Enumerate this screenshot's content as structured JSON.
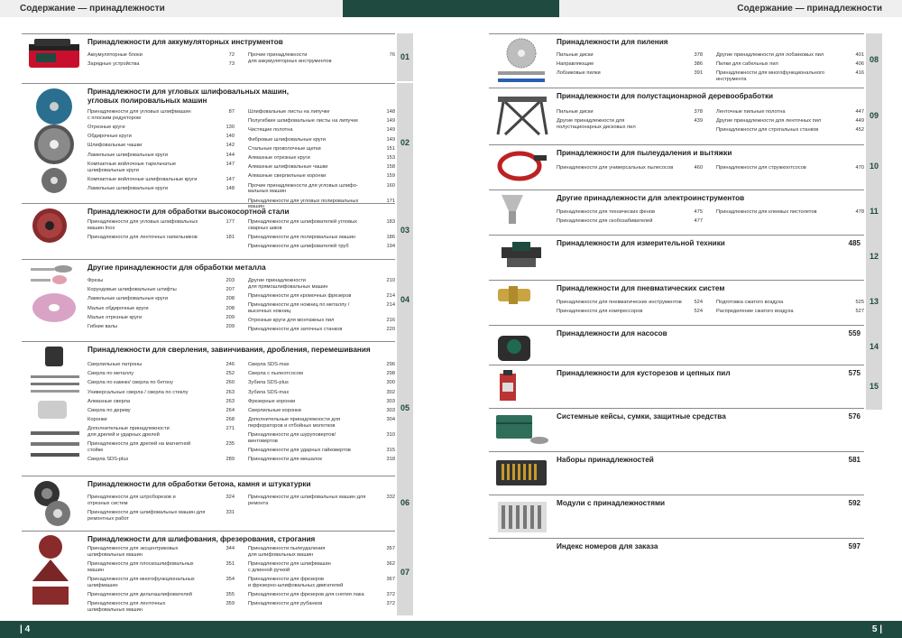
{
  "header": {
    "left_title": "Содержание — принадлежности",
    "right_title": "Содержание — принадлежности"
  },
  "footer": {
    "left_page": "| 4",
    "right_page": "5 |"
  },
  "left_sections": [
    {
      "tab": "01",
      "title": "Принадлежности для аккумуляторных инструментов",
      "items_left": [
        [
          "Аккумуляторные блоки",
          "72"
        ],
        [
          "Зарядные устройства",
          "73"
        ]
      ],
      "items_right": [
        [
          "Прочие принадлежности\nдля аккумуляторных инструментов",
          "76"
        ]
      ]
    },
    {
      "tab": "02",
      "title": "Принадлежности для угловых шлифовальных машин,\nугловых полировальных машин",
      "items_left": [
        [
          "Принадлежности для угловых шлифмашин\nс плоским редуктором",
          "87"
        ],
        [
          "Отрезные круги",
          "130"
        ],
        [
          "Обдирочные круги",
          "140"
        ],
        [
          "Шлифовальные чашки",
          "142"
        ],
        [
          "Ламельные шлифовальные круги",
          "144"
        ],
        [
          "Компактные войлочные тарельчатые\nшлифовальные круги",
          "147"
        ],
        [
          "Компактные войлочные шлифовальные круги",
          "147"
        ],
        [
          "Ламельные шлифовальные круги",
          "148"
        ]
      ],
      "items_right": [
        [
          "Шлифовальные листы на липучке",
          "148"
        ],
        [
          "Полугибкие шлифовальные листы на липучке",
          "149"
        ],
        [
          "Чистящие полотна",
          "149"
        ],
        [
          "Фибровые шлифовальные круги",
          "149"
        ],
        [
          "Стальные проволочные щетки",
          "151"
        ],
        [
          "Алмазные отрезные круги",
          "153"
        ],
        [
          "Алмазные шлифовальные чашки",
          "158"
        ],
        [
          "Алмазные сверлильные коронки",
          "159"
        ],
        [
          "Прочие принадлежности для угловых шлифо-\nвальных машин",
          "160"
        ],
        [
          "Принадлежности для угловых полировальных\nмашин",
          "171"
        ]
      ]
    },
    {
      "tab": "03",
      "title": "Принадлежности для обработки высокосортной стали",
      "items_left": [
        [
          "Принадлежности для угловых шлифовальных\nмашин Inox",
          "177"
        ],
        [
          "Принадлежности для ленточных напильников",
          "181"
        ]
      ],
      "items_right": [
        [
          "Принадлежности для шлифователей угловых\nсварных швов",
          "183"
        ],
        [
          "Принадлежности для полировальных машин",
          "186"
        ],
        [
          "Принадлежности для шлифователей труб",
          "194"
        ]
      ]
    },
    {
      "tab": "04",
      "title": "Другие принадлежности для обработки металла",
      "items_left": [
        [
          "Фрезы",
          "203"
        ],
        [
          "Корундовые шлифовальные штифты",
          "207"
        ],
        [
          "Ламельные шлифовальные круги",
          "208"
        ],
        [
          "Малые обдирочные круги",
          "208"
        ],
        [
          "Малые отрезные круги",
          "209"
        ],
        [
          "Гибкие валы",
          "209"
        ]
      ],
      "items_right": [
        [
          "Другие принадлежности\nдля прямошлифовальных машин",
          "210"
        ],
        [
          "Принадлежности для кромочных фрезеров",
          "214"
        ],
        [
          "Принадлежности для ножниц по металлу /\nвысечных ножниц",
          "214"
        ],
        [
          "Отрезные круги для монтажных пил",
          "216"
        ],
        [
          "Принадлежности для заточных станков",
          "220"
        ]
      ]
    },
    {
      "tab": "05",
      "title": "Принадлежности для сверления, завинчивания, дробления, перемешивания",
      "items_left": [
        [
          "Сверлильные патроны",
          "246"
        ],
        [
          "Сверла по металлу",
          "252"
        ],
        [
          "Сверла по камню/ сверла по бетону",
          "260"
        ],
        [
          "Универсальные сверла / сверла по стеклу",
          "263"
        ],
        [
          "Алмазные сверла",
          "263"
        ],
        [
          "Сверла по дереву",
          "264"
        ],
        [
          "Коронки",
          "268"
        ],
        [
          "Дополнительные принадлежности\nдля дрелей и ударных дрелей",
          "271"
        ],
        [
          "Принадлежности для дрелей на магнитной\nстойке",
          "235"
        ],
        [
          "Сверла SDS-plus",
          "289"
        ]
      ],
      "items_right": [
        [
          "Сверла SDS-max",
          "296"
        ],
        [
          "Сверла с пылеотсосом",
          "298"
        ],
        [
          "Зубила SDS-plus",
          "300"
        ],
        [
          "Зубила SDS-max",
          "302"
        ],
        [
          "Фрезерные коронки",
          "303"
        ],
        [
          "Сверлильные коронки",
          "303"
        ],
        [
          "Дополнительные принадлежности для\nперфораторов и отбойных молотков",
          "304"
        ],
        [
          "Принадлежности для шуруповертов/\nвинтовертов",
          "310"
        ],
        [
          "Принадлежности для ударных гайковертов",
          "315"
        ],
        [
          "Принадлежности для мешалок",
          "318"
        ]
      ]
    },
    {
      "tab": "06",
      "title": "Принадлежности для обработки бетона, камня и штукатурки",
      "items_left": [
        [
          "Принадлежности для штроборезов и\nотрезных систем",
          "324"
        ],
        [
          "Принадлежности для шлифовальных машин для\nремонтных работ",
          "331"
        ]
      ],
      "items_right": [
        [
          "Принадлежности для шлифовальных машин для\nремонта",
          "332"
        ]
      ]
    },
    {
      "tab": "07",
      "title": "Принадлежности для шлифования, фрезерования, строгания",
      "items_left": [
        [
          "Принадлежности для эксцентриковых\nшлифовальных машин",
          "344"
        ],
        [
          "Принадлежности для плоскошлифовальных\nмашин",
          "351"
        ],
        [
          "Принадлежности для многофункциональных\nшлифмашин",
          "354"
        ],
        [
          "Принадлежности для дельташлифователей",
          "355"
        ],
        [
          "Принадлежности для ленточных\nшлифовальных машин",
          "359"
        ]
      ],
      "items_right": [
        [
          "Принадлежности пылеудаления\nдля шлифовальных машин",
          "357"
        ],
        [
          "Принадлежности для шлифмашин\nс длинной ручкой",
          "362"
        ],
        [
          "Принадлежности для фрезеров\nи фрезерно-шлифовальных двигателей",
          "367"
        ],
        [
          "Принадлежности для фрезеров для снятия лака",
          "372"
        ],
        [
          "Принадлежности для рубанков",
          "372"
        ]
      ]
    }
  ],
  "right_sections": [
    {
      "tab": "08",
      "title": "Принадлежности для пиления",
      "items_left": [
        [
          "Пильные диски",
          "378"
        ],
        [
          "Направляющие",
          "386"
        ],
        [
          "Лобзиковые пилки",
          "391"
        ]
      ],
      "items_right": [
        [
          "Другие принадлежности для лобзиковых пил",
          "401"
        ],
        [
          "Пилки для сабельных пил",
          "406"
        ],
        [
          "Принадлежности для многофункционального\nинструмента",
          "416"
        ]
      ]
    },
    {
      "tab": "09",
      "title": "Принадлежности для полустационарной деревообработки",
      "items_left": [
        [
          "Пильные диски",
          "378"
        ],
        [
          "Другие принадлежности для\nполустационарных дисковых пил",
          "439"
        ]
      ],
      "items_right": [
        [
          "Ленточные пильные полотна",
          "447"
        ],
        [
          "Другие принадлежности для ленточных пил",
          "449"
        ],
        [
          "Принадлежности для строгальных станков",
          "452"
        ]
      ]
    },
    {
      "tab": "10",
      "title": "Принадлежности для пылеудаления и вытяжки",
      "items_left": [
        [
          "Принадлежности для универсальных пылесосов",
          "460"
        ]
      ],
      "items_right": [
        [
          "Принадлежности для стружкоотсосов",
          "470"
        ]
      ]
    },
    {
      "tab": "11",
      "title": "Другие принадлежности для электроинструментов",
      "items_left": [
        [
          "Принадлежности для технических фенов",
          "475"
        ],
        [
          "Принадлежности для скобозабивателей",
          "477"
        ]
      ],
      "items_right": [
        [
          "Принадлежности для клеевых пистолетов",
          "478"
        ]
      ]
    },
    {
      "tab": "12",
      "title": "Принадлежности для измерительной техники",
      "page": "485"
    },
    {
      "tab": "13",
      "title": "Принадлежности для пневматических систем",
      "items_left": [
        [
          "Принадлежности для пневматических инструментов",
          "524"
        ],
        [
          "Принадлежности для компрессоров",
          "524"
        ]
      ],
      "items_right": [
        [
          "Подготовка сжатого воздуха",
          "525"
        ],
        [
          "Распределение сжатого воздуха",
          "527"
        ]
      ]
    },
    {
      "tab": "14",
      "title": "Принадлежности для насосов",
      "page": "559"
    },
    {
      "tab": "15",
      "title": "Принадлежности для кусторезов и цепных пил",
      "page": "575"
    },
    {
      "tab": "",
      "title": "Системные кейсы, сумки, защитные средства",
      "page": "576"
    },
    {
      "tab": "",
      "title": "Наборы принадлежностей",
      "page": "581"
    },
    {
      "tab": "",
      "title": "Модули с принадлежностями",
      "page": "592"
    },
    {
      "tab": "",
      "title": "Индекс номеров для заказа",
      "page": "597"
    }
  ],
  "colors": {
    "brand": "#1e4a40",
    "tab": "#d8d8d8"
  },
  "icons": [
    "battery-pack-image",
    "grinding-disc-image",
    "flap-disc-image",
    "mounted-points-image",
    "drill-bits-image",
    "concrete-grinder-image",
    "sanding-sheets-image",
    "saw-blade-image",
    "workbench-stand-image",
    "vacuum-hose-image",
    "heat-gun-nozzle-image",
    "measuring-tool-image",
    "air-coupling-image",
    "pump-image",
    "chain-oil-image",
    "system-case-image",
    "bit-set-image",
    "accessory-module-image"
  ]
}
